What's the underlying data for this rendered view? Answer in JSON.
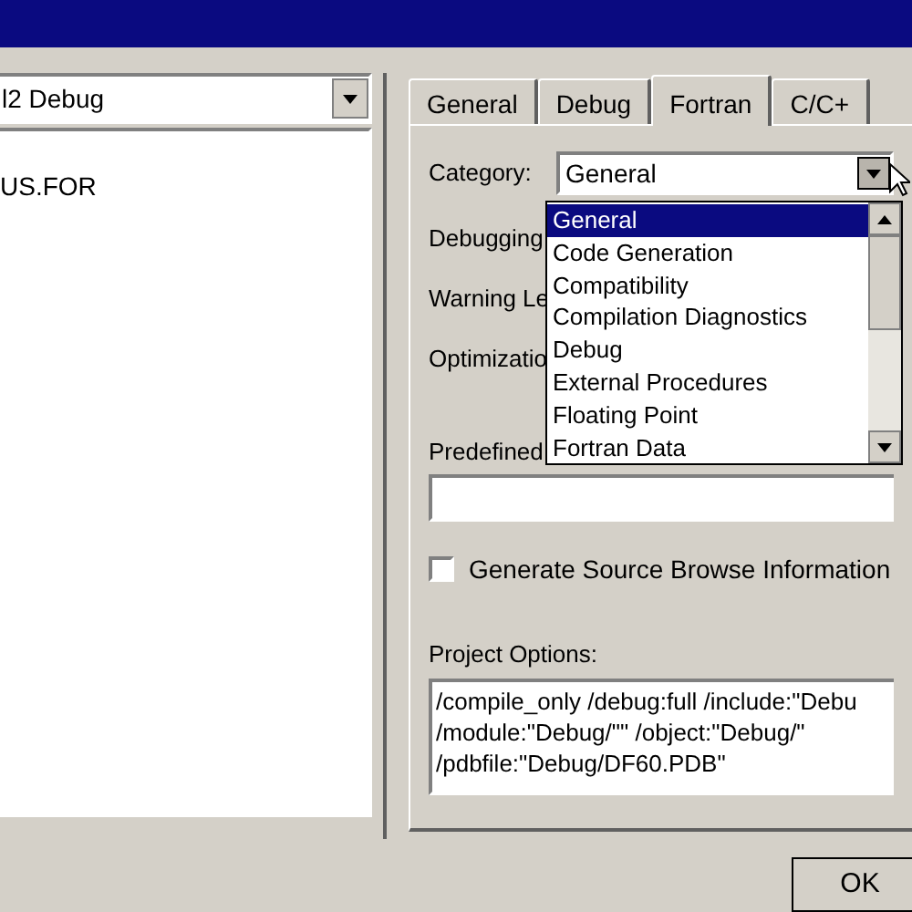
{
  "left_panel": {
    "configuration": "l2 Debug",
    "tree_items": [
      "US.FOR"
    ]
  },
  "tabs": [
    {
      "label": "General",
      "selected": false
    },
    {
      "label": "Debug",
      "selected": false
    },
    {
      "label": "Fortran",
      "selected": true
    },
    {
      "label": "C/C+",
      "selected": false
    }
  ],
  "category": {
    "label": "Category:",
    "value": "General",
    "expanded": true,
    "options": [
      {
        "label": "General",
        "selected": true
      },
      {
        "label": "Code Generation",
        "selected": false
      },
      {
        "label": "Compatibility",
        "selected": false
      },
      {
        "label": "Compilation Diagnostics",
        "selected": false
      },
      {
        "label": "Debug",
        "selected": false
      },
      {
        "label": "External Procedures",
        "selected": false
      },
      {
        "label": "Floating Point",
        "selected": false
      },
      {
        "label": "Fortran Data",
        "selected": false
      }
    ]
  },
  "hidden_labels": [
    {
      "label": "Debugging"
    },
    {
      "label": "Warning Le"
    },
    {
      "label": "Optimizatio"
    }
  ],
  "preprocessor": {
    "label": "Predefined"
  },
  "browse_info": {
    "label": "Generate Source Browse Information",
    "checked": false
  },
  "project_options": {
    "label": "Project Options:",
    "lines": [
      "/compile_only /debug:full /include:\"Debu",
      "/module:\"Debug/\"\" /object:\"Debug/\"",
      "/pdbfile:\"Debug/DF60.PDB\""
    ]
  },
  "buttons": [
    "OK"
  ]
}
